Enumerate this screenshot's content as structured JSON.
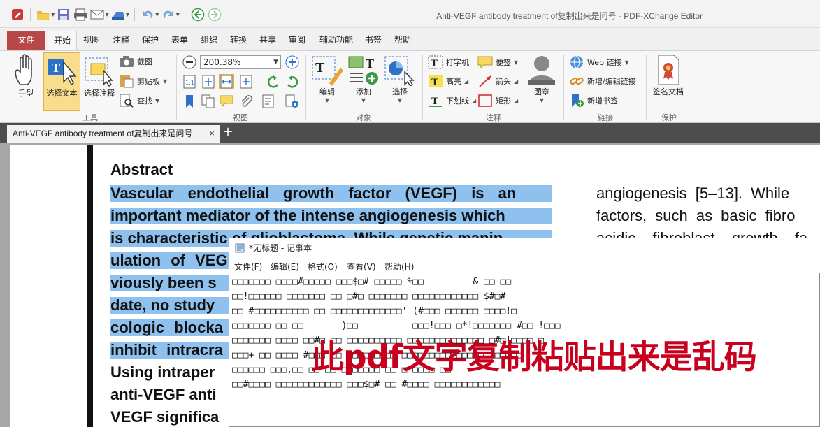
{
  "window": {
    "title": "Anti-VEGF antibody treatment of复制出来是问号 - PDF-XChange Editor"
  },
  "menu": {
    "tabs": [
      "文件",
      "开始",
      "视图",
      "注释",
      "保护",
      "表单",
      "组织",
      "转换",
      "共享",
      "审阅",
      "辅助功能",
      "书签",
      "帮助"
    ],
    "active": "开始"
  },
  "ribbon": {
    "tools": {
      "hand": "手型",
      "select_text": "选择文本",
      "select_annot": "选择注释",
      "screenshot": "截图",
      "clipboard": "剪贴板",
      "find": "查找",
      "label": "工具"
    },
    "view": {
      "zoom": "200.38%",
      "label": "视图"
    },
    "objects": {
      "edit": "编辑",
      "add": "添加",
      "select": "选择",
      "label": "对象"
    },
    "annot": {
      "typewriter": "打字机",
      "sticky": "便签",
      "highlight": "高亮",
      "arrow": "箭头",
      "underline": "下划线",
      "rect": "矩形",
      "stamp": "图章",
      "label": "注释"
    },
    "links": {
      "web": "Web 链接",
      "add_edit": "新增/编辑链接",
      "bookmark": "新增书签",
      "label": "链接"
    },
    "protect": {
      "sign": "签名文档",
      "label": "保护"
    }
  },
  "doc_tab": {
    "title": "Anti-VEGF antibody treatment of复制出来是问号",
    "close": "×",
    "add": "+"
  },
  "pdf": {
    "heading": "Abstract",
    "left_lines": [
      "Vascular endothelial growth factor (VEGF) is an",
      "important mediator of the intense angiogenesis which",
      "is characteristic of glioblastoma. While genetic manip-",
      "ulation of VEG",
      "viously been s",
      "date, no study",
      "cologic blocka",
      "inhibit intracra",
      "Using intraper",
      "anti-VEGF anti",
      "VEGF significa"
    ],
    "right_lines": [
      "angiogenesis [5–13]. While",
      "factors, such as basic fibro",
      "acidic fibroblast growth fa"
    ]
  },
  "notepad": {
    "title": "*无标题 - 记事本",
    "menu": [
      "文件(F)",
      "编辑(E)",
      "格式(O)",
      "查看(V)",
      "帮助(H)"
    ],
    "lines": [
      "□□□□□□□ □□□□#□□□□□ □□□$□# □□□□□ %□□         & □□ □□",
      "□□!□□□□□□ □□□□□□□ □□ □#□ □□□□□□□ □□□□□□□□□□□□ $#□#",
      "□□ #□□□□□□□□□□ □□ □□□□□□□□□□□□□' (#□□□ □□□□□□ □□□□!□",
      "□□□□□□□ □□ □□       )□□          □□□!□□□ □*!□□□□□□□ #□□ !□□□",
      "□□□□□□□ □□□□ □□#□ □□ □□□□□□□□□□ □□□□□□□□□□□□□□ □#□!□□□□ □",
      "□□□+ □□ □□□□ #□□□ □□ □□□□□□□□□ □□□□□□□□□□□□□□□□!□□□□□",
      "□□□□□□ □□□,□□ □□ □□ □□□□□□□ □□ □ □□□□ □□",
      "□□#□□□□ □□□□□□□□□□□□ □□□$□# □□ #□□□□ □□□□□□□□□□□□"
    ]
  },
  "overlay_note": "此pdf文字复制粘贴出来是乱码"
}
